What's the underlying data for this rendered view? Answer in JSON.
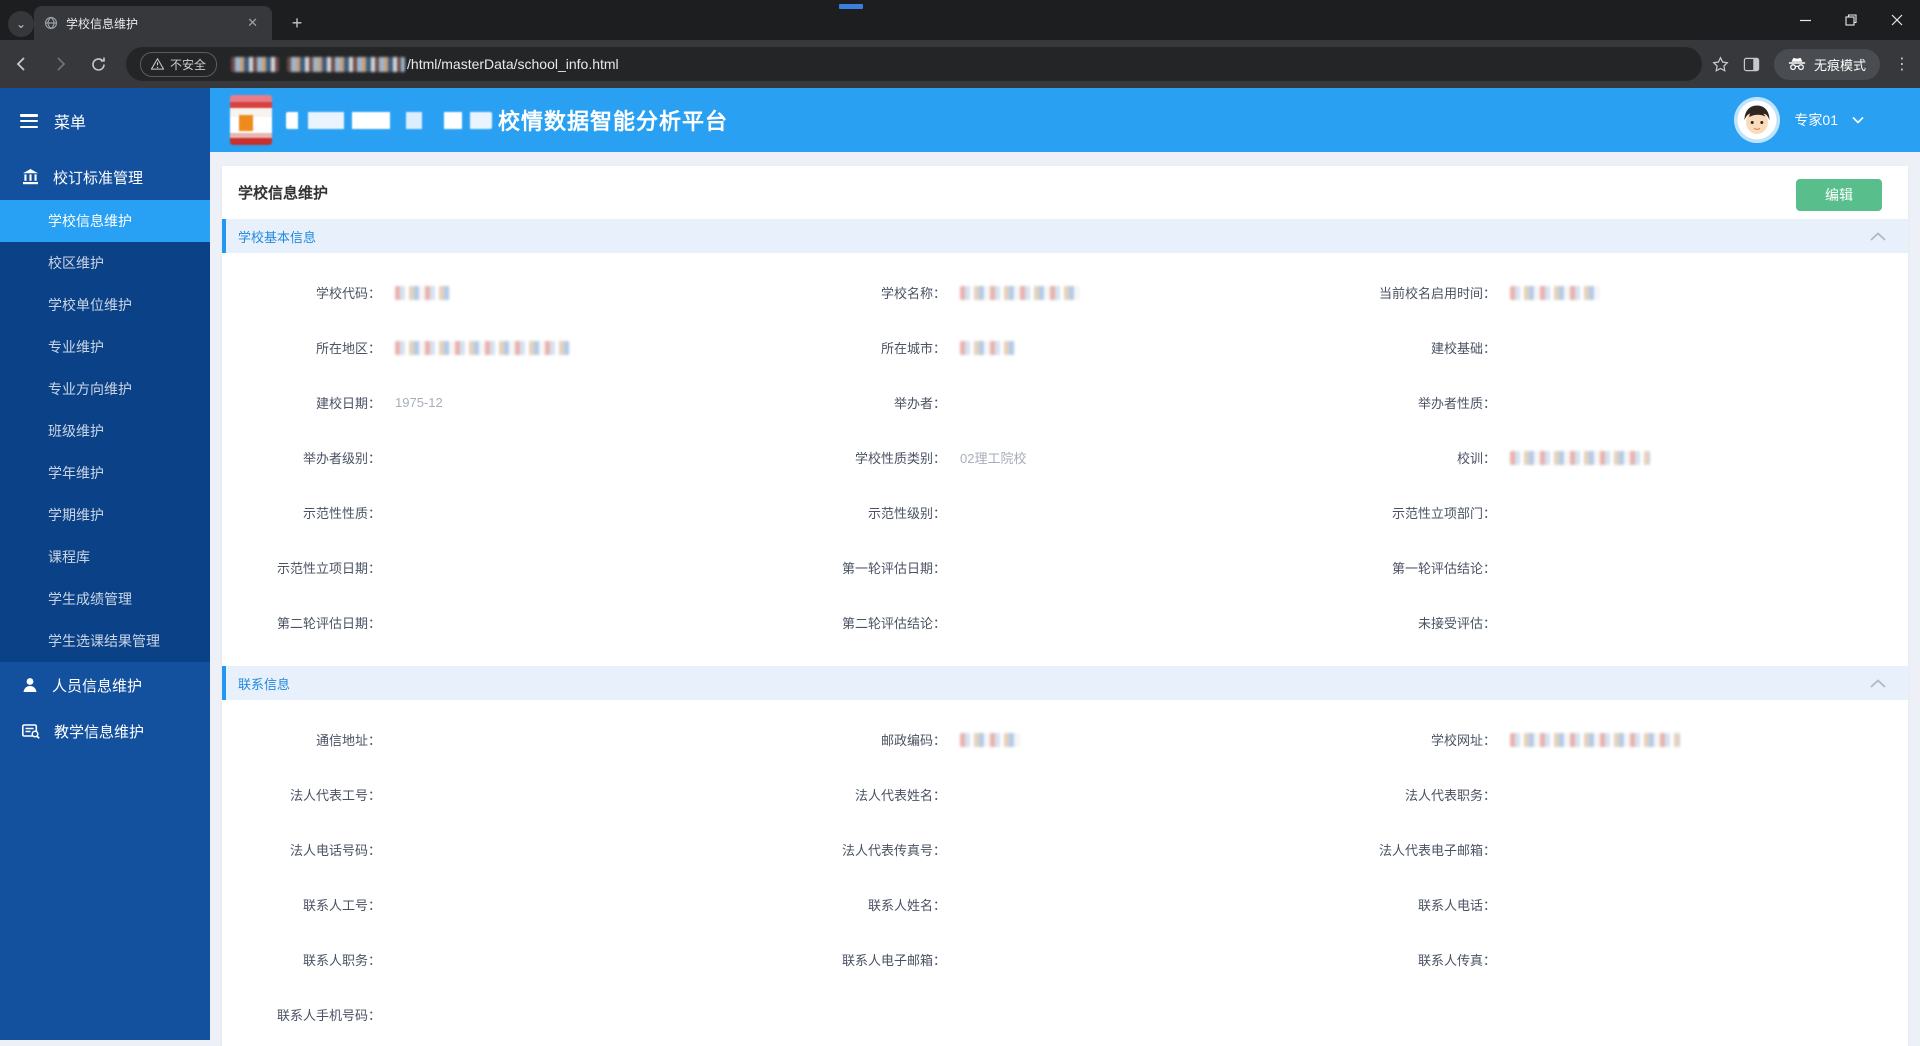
{
  "browser": {
    "tab_title": "学校信息维护",
    "security_label": "不安全",
    "url_path": "/html/masterData/school_info.html",
    "incognito_label": "无痕模式"
  },
  "header": {
    "platform_title": "校情数据智能分析平台",
    "user_name": "专家01"
  },
  "sidebar": {
    "menu_label": "菜单",
    "items": [
      {
        "label": "校订标准管理",
        "type": "section",
        "icon": "bank-icon"
      },
      {
        "label": "学校信息维护",
        "type": "sub",
        "active": true
      },
      {
        "label": "校区维护",
        "type": "sub"
      },
      {
        "label": "学校单位维护",
        "type": "sub"
      },
      {
        "label": "专业维护",
        "type": "sub"
      },
      {
        "label": "专业方向维护",
        "type": "sub"
      },
      {
        "label": "班级维护",
        "type": "sub"
      },
      {
        "label": "学年维护",
        "type": "sub"
      },
      {
        "label": "学期维护",
        "type": "sub"
      },
      {
        "label": "课程库",
        "type": "sub"
      },
      {
        "label": "学生成绩管理",
        "type": "sub"
      },
      {
        "label": "学生选课结果管理",
        "type": "sub"
      },
      {
        "label": "人员信息维护",
        "type": "section",
        "icon": "person-icon"
      },
      {
        "label": "教学信息维护",
        "type": "section",
        "icon": "teaching-icon"
      }
    ]
  },
  "main": {
    "page_title": "学校信息维护",
    "edit_button_label": "编辑",
    "sections": [
      {
        "title": "学校基本信息",
        "fields": [
          {
            "label": "学校代码",
            "redact": 55
          },
          {
            "label": "学校名称",
            "redact": 120
          },
          {
            "label": "当前校名启用时间",
            "redact": 90
          },
          {
            "label": "所在地区",
            "redact": 175
          },
          {
            "label": "所在城市",
            "redact": 55
          },
          {
            "label": "建校基础",
            "value": ""
          },
          {
            "label": "建校日期",
            "value": "1975-12"
          },
          {
            "label": "举办者",
            "value": ""
          },
          {
            "label": "举办者性质",
            "value": ""
          },
          {
            "label": "举办者级别",
            "value": ""
          },
          {
            "label": "学校性质类别",
            "value": "02理工院校"
          },
          {
            "label": "校训",
            "redact": 140
          },
          {
            "label": "示范性性质",
            "value": ""
          },
          {
            "label": "示范性级别",
            "value": ""
          },
          {
            "label": "示范性立项部门",
            "value": ""
          },
          {
            "label": "示范性立项日期",
            "value": ""
          },
          {
            "label": "第一轮评估日期",
            "value": ""
          },
          {
            "label": "第一轮评估结论",
            "value": ""
          },
          {
            "label": "第二轮评估日期",
            "value": ""
          },
          {
            "label": "第二轮评估结论",
            "value": ""
          },
          {
            "label": "未接受评估",
            "value": ""
          }
        ]
      },
      {
        "title": "联系信息",
        "fields": [
          {
            "label": "通信地址",
            "value": ""
          },
          {
            "label": "邮政编码",
            "redact": 60
          },
          {
            "label": "学校网址",
            "redact": 170
          },
          {
            "label": "法人代表工号",
            "value": ""
          },
          {
            "label": "法人代表姓名",
            "value": ""
          },
          {
            "label": "法人代表职务",
            "value": ""
          },
          {
            "label": "法人电话号码",
            "value": ""
          },
          {
            "label": "法人代表传真号",
            "value": ""
          },
          {
            "label": "法人代表电子邮箱",
            "value": ""
          },
          {
            "label": "联系人工号",
            "value": ""
          },
          {
            "label": "联系人姓名",
            "value": ""
          },
          {
            "label": "联系人电话",
            "value": ""
          },
          {
            "label": "联系人职务",
            "value": ""
          },
          {
            "label": "联系人电子邮箱",
            "value": ""
          },
          {
            "label": "联系人传真",
            "value": ""
          },
          {
            "label": "联系人手机号码",
            "value": ""
          }
        ]
      }
    ]
  }
}
